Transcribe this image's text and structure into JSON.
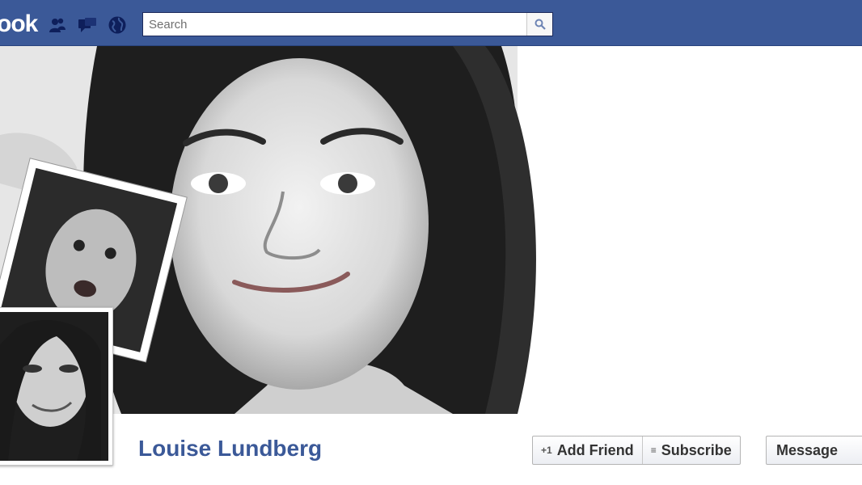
{
  "topbar": {
    "logo_text": "ook",
    "icons": [
      "friend-requests-icon",
      "messages-icon",
      "notifications-globe-icon"
    ],
    "search": {
      "placeholder": "Search",
      "value": ""
    },
    "search_button_icon": "magnifier-icon",
    "color": "#3b5998"
  },
  "profile": {
    "name": "Louise Lundberg",
    "name_color": "#3b5998"
  },
  "actions": {
    "add_friend": {
      "label": "Add Friend",
      "icon_text": "+1"
    },
    "subscribe": {
      "label": "Subscribe",
      "icon_text": "≡"
    },
    "message": {
      "label": "Message"
    }
  }
}
